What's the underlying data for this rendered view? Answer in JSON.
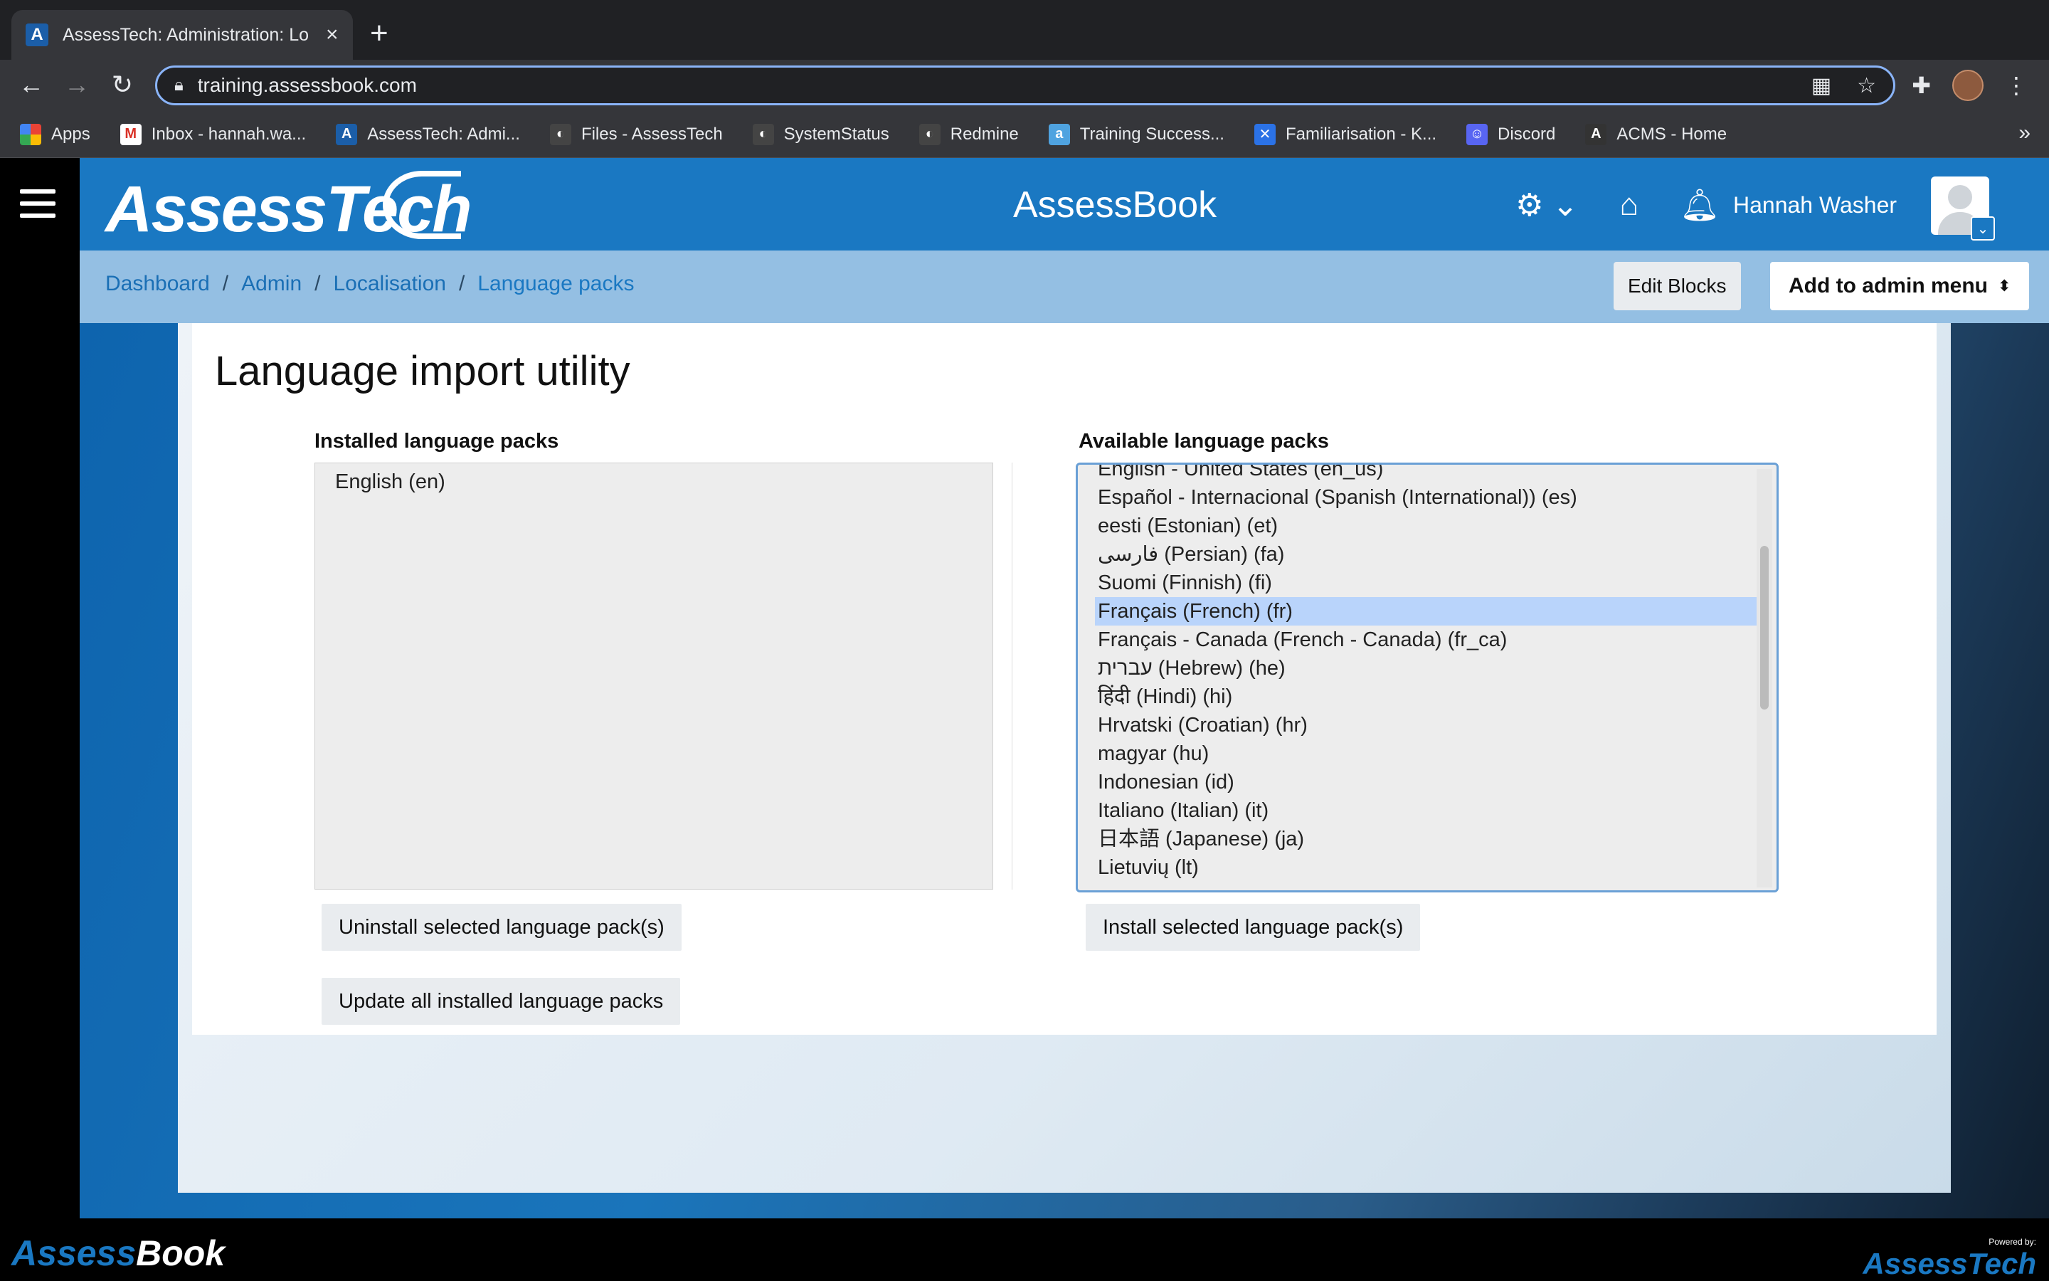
{
  "browser": {
    "tab_title": "AssessTech: Administration: Lo",
    "url": "training.assessbook.com",
    "bookmarks": [
      {
        "label": "Apps"
      },
      {
        "label": "Inbox - hannah.wa..."
      },
      {
        "label": "AssessTech: Admi..."
      },
      {
        "label": "Files - AssessTech"
      },
      {
        "label": "SystemStatus"
      },
      {
        "label": "Redmine"
      },
      {
        "label": "Training Success..."
      },
      {
        "label": "Familiarisation - K..."
      },
      {
        "label": "Discord"
      },
      {
        "label": "ACMS - Home"
      }
    ],
    "more": "»"
  },
  "header": {
    "logo": "AssessTech",
    "center_title": "AssessBook",
    "user_name": "Hannah Washer"
  },
  "breadcrumbs": {
    "dashboard": "Dashboard",
    "admin": "Admin",
    "localisation": "Localisation",
    "current": "Language packs",
    "sep": "/"
  },
  "actions": {
    "edit_blocks": "Edit Blocks",
    "add_admin_menu": "Add to admin menu"
  },
  "main": {
    "title": "Language import utility",
    "installed_label": "Installed language packs",
    "available_label": "Available language packs",
    "installed": [
      "English (en)"
    ],
    "available": [
      "English - United States (en_us)",
      "Español - Internacional (Spanish (International)) (es)",
      "eesti (Estonian) (et)",
      "فارسی (Persian) (fa)",
      "Suomi (Finnish) (fi)",
      "Français (French) (fr)",
      "Français - Canada (French - Canada) (fr_ca)",
      "עברית (Hebrew) (he)",
      "हिंदी (Hindi) (hi)",
      "Hrvatski (Croatian) (hr)",
      "magyar (hu)",
      "Indonesian (id)",
      "Italiano (Italian) (it)",
      "日本語 (Japanese) (ja)",
      "Lietuvių (lt)"
    ],
    "selected_index": 5,
    "uninstall_button": "Uninstall selected language pack(s)",
    "update_button": "Update all installed language packs",
    "install_button": "Install selected language pack(s)"
  },
  "footer": {
    "left_logo_a": "Assess",
    "left_logo_b": "Book",
    "powered_by": "Powered by:",
    "right_logo": "AssessTech"
  }
}
